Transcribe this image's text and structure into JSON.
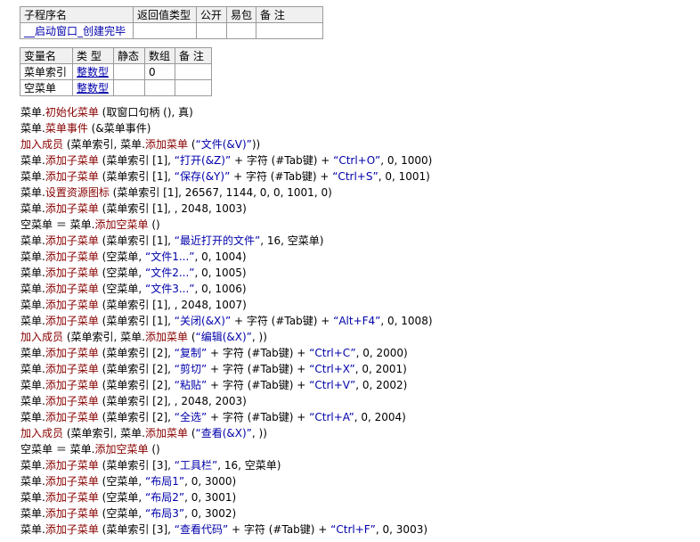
{
  "subroutine_table": {
    "headers": [
      "子程序名",
      "返回值类型",
      "公开",
      "易包",
      "备 注"
    ],
    "row": [
      "__启动窗口_创建完毕",
      "",
      "",
      "",
      ""
    ]
  },
  "variable_table": {
    "headers": [
      "变量名",
      "类 型",
      "静态",
      "数组",
      "备 注"
    ],
    "rows": [
      [
        "菜单索引",
        "整数型",
        "",
        "0",
        ""
      ],
      [
        "空菜单",
        "整数型",
        "",
        "",
        ""
      ]
    ]
  },
  "code_lines": [
    "菜单.初始化菜单 (取窗口句柄 (), 真)",
    "菜单.菜单事件 (&菜单事件)",
    "加入成员 (菜单索引, 菜单.添加菜单 (“文件(&V)”))",
    "菜单.添加子菜单 (菜单索引 [1], “打开(&Z)” + 字符 (#Tab键) + “Ctrl+O”, 0, 1000)",
    "菜单.添加子菜单 (菜单索引 [1], “保存(&Y)” + 字符 (#Tab键) + “Ctrl+S”, 0, 1001)",
    "菜单.设置资源图标 (菜单索引 [1], 26567, 1144, 0, 0, 1001, 0)",
    "菜单.添加子菜单 (菜单索引 [1], , 2048, 1003)",
    "空菜单 ＝ 菜单.添加空菜单 ()",
    "菜单.添加子菜单 (菜单索引 [1], “最近打开的文件”, 16, 空菜单)",
    "菜单.添加子菜单 (空菜单, “文件1...”, 0, 1004)",
    "菜单.添加子菜单 (空菜单, “文件2...”, 0, 1005)",
    "菜单.添加子菜单 (空菜单, “文件3...”, 0, 1006)",
    "菜单.添加子菜单 (菜单索引 [1], , 2048, 1007)",
    "菜单.添加子菜单 (菜单索引 [1], “关闭(&X)” + 字符 (#Tab键) + “Alt+F4”, 0, 1008)",
    "加入成员 (菜单索引, 菜单.添加菜单 (“编辑(&X)”, ))",
    "菜单.添加子菜单 (菜单索引 [2], “复制” + 字符 (#Tab键) + “Ctrl+C”, 0, 2000)",
    "菜单.添加子菜单 (菜单索引 [2], “剪切” + 字符 (#Tab键) + “Ctrl+X”, 0, 2001)",
    "菜单.添加子菜单 (菜单索引 [2], “粘贴” + 字符 (#Tab键) + “Ctrl+V”, 0, 2002)",
    "菜单.添加子菜单 (菜单索引 [2], , 2048, 2003)",
    "菜单.添加子菜单 (菜单索引 [2], “全选” + 字符 (#Tab键) + “Ctrl+A”, 0, 2004)",
    "加入成员 (菜单索引, 菜单.添加菜单 (“查看(&X)”, ))",
    "空菜单 ＝ 菜单.添加空菜单 ()",
    "菜单.添加子菜单 (菜单索引 [3], “工具栏”, 16, 空菜单)",
    "菜单.添加子菜单 (空菜单, “布局1”, 0, 3000)",
    "菜单.添加子菜单 (空菜单, “布局2”, 0, 3001)",
    "菜单.添加子菜单 (空菜单, “布局3”, 0, 3002)",
    "菜单.添加子菜单 (菜单索引 [3], “查看代码” + 字符 (#Tab键) + “Ctrl+F”, 0, 3003)"
  ],
  "colors": {
    "method": "#880000",
    "string": "#0000aa",
    "type_link": "#0000aa"
  }
}
